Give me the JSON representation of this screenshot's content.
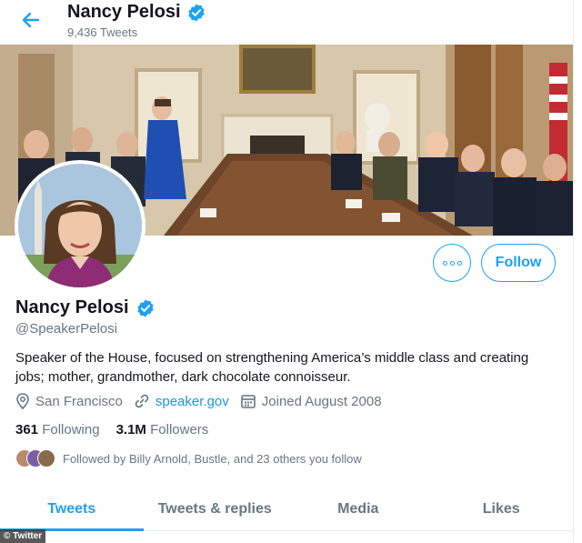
{
  "header": {
    "title": "Nancy Pelosi",
    "tweet_count": "9,436 Tweets"
  },
  "profile": {
    "name": "Nancy Pelosi",
    "handle": "@SpeakerPelosi",
    "bio": "Speaker of the House, focused on strengthening America’s middle class and creating jobs; mother, grandmother, dark chocolate connoisseur.",
    "location": "San Francisco",
    "website": "speaker.gov",
    "joined": "Joined August 2008",
    "following_count": "361",
    "following_label": "Following",
    "followers_count": "3.1M",
    "followers_label": "Followers",
    "followed_by": "Followed by Billy Arnold, Bustle, and 23 others you follow"
  },
  "actions": {
    "follow_label": "Follow",
    "more_icon": "more-icon"
  },
  "tabs": [
    {
      "label": "Tweets",
      "active": true
    },
    {
      "label": "Tweets & replies",
      "active": false
    },
    {
      "label": "Media",
      "active": false
    },
    {
      "label": "Likes",
      "active": false
    }
  ],
  "watermark": "© Twitter",
  "colors": {
    "accent": "#1da1f2",
    "verified": "#1da1f2",
    "secondary_text": "#657786"
  }
}
